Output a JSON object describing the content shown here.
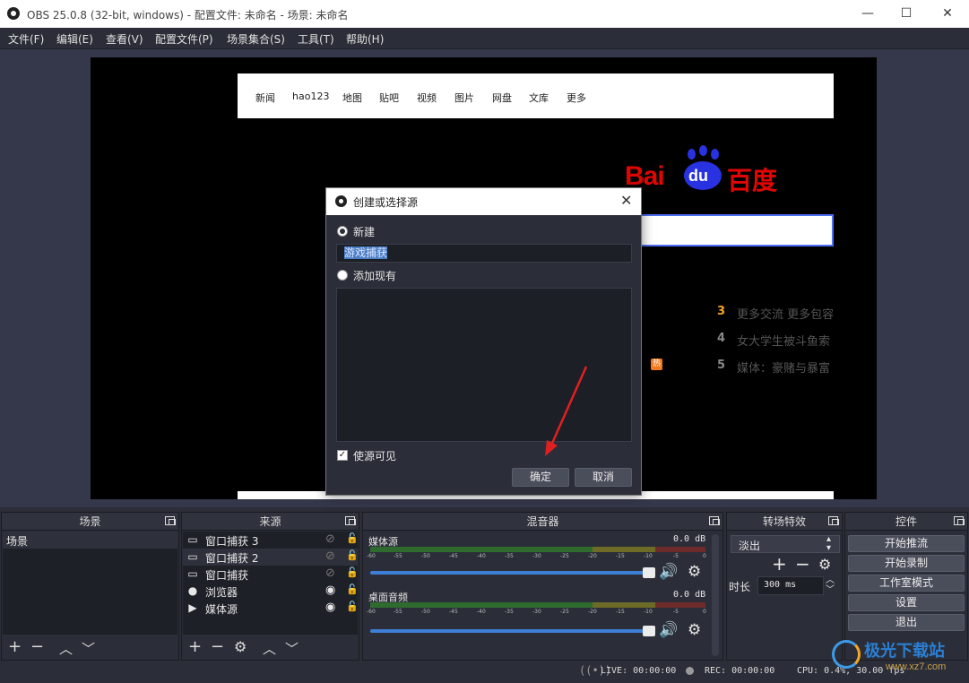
{
  "window": {
    "title": "OBS 25.0.8 (32-bit, windows) - 配置文件: 未命名 - 场景: 未命名",
    "min_glyph": "—",
    "max_glyph": "☐",
    "close_glyph": "✕"
  },
  "menu": [
    "文件(F)",
    "编辑(E)",
    "查看(V)",
    "配置文件(P)",
    "场景集合(S)",
    "工具(T)",
    "帮助(H)"
  ],
  "preview": {
    "web_nav": [
      "新闻",
      "hao123",
      "地图",
      "贴吧",
      "视频",
      "图片",
      "网盘",
      "文库",
      "更多"
    ],
    "logo_left": "Bai",
    "logo_mid": "du",
    "logo_right": "百度",
    "hot_items": [
      {
        "num": "3",
        "text": "更多交流 更多包容"
      },
      {
        "num": "4",
        "text": "女大学生被斗鱼索"
      },
      {
        "num": "5",
        "text": "媒体：豪赌与暴富"
      }
    ],
    "hot_badge": "热"
  },
  "dialog": {
    "title": "创建或选择源",
    "close_glyph": "✕",
    "new_label": "新建",
    "name_value": "游戏捕获",
    "existing_label": "添加现有",
    "visible_label": "使源可见",
    "visible_checked": true,
    "ok_label": "确定",
    "cancel_label": "取消"
  },
  "docks": {
    "scenes": {
      "title": "场景",
      "items": [
        "场景"
      ]
    },
    "sources": {
      "title": "来源",
      "items": [
        {
          "label": "窗口捕获 3",
          "icon": "window-icon",
          "visible": false
        },
        {
          "label": "窗口捕获 2",
          "icon": "window-icon",
          "visible": false
        },
        {
          "label": "窗口捕获",
          "icon": "window-icon",
          "visible": false
        },
        {
          "label": "浏览器",
          "icon": "globe-icon",
          "visible": true
        },
        {
          "label": "媒体源",
          "icon": "play-icon",
          "visible": true
        }
      ]
    },
    "mixer": {
      "title": "混音器",
      "channels": [
        {
          "name": "媒体源",
          "level": "0.0 dB"
        },
        {
          "name": "桌面音频",
          "level": "0.0 dB"
        }
      ],
      "ticks": [
        "-60",
        "-55",
        "-50",
        "-45",
        "-40",
        "-35",
        "-30",
        "-25",
        "-20",
        "-15",
        "-10",
        "-5",
        "0"
      ]
    },
    "transitions": {
      "title": "转场特效",
      "selected": "淡出",
      "duration_label": "时长",
      "duration_value": "300 ms"
    },
    "controls": {
      "title": "控件",
      "buttons": [
        "开始推流",
        "开始录制",
        "工作室模式",
        "设置",
        "退出"
      ]
    }
  },
  "status": {
    "live": "LIVE: 00:00:00",
    "rec": "REC: 00:00:00",
    "cpu": "CPU: 0.4%, 30.00 fps"
  },
  "watermark": {
    "main": "极光下载站",
    "url": "www.xz7.com"
  },
  "colors": {
    "accent": "#3d7fd6",
    "arrow": "#e02020",
    "baidu_red": "#e10602",
    "baidu_blue": "#2932e1"
  }
}
